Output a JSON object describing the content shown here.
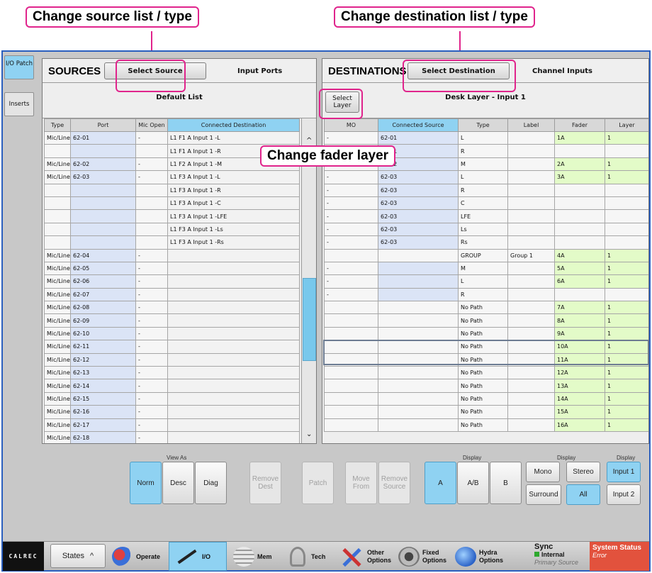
{
  "callouts": {
    "source": "Change source list / type",
    "destination": "Change destination list / type",
    "fader_layer": "Change fader layer"
  },
  "tabs": [
    {
      "label": "I/O Patch",
      "active": true
    },
    {
      "label": "Inserts",
      "active": false
    }
  ],
  "sources": {
    "title": "SOURCES",
    "select_button": "Select Source",
    "subtitle": "Input Ports",
    "list_name": "Default List",
    "columns": [
      "Type",
      "Port",
      "Mic Open",
      "Connected Destination"
    ],
    "rows": [
      [
        "Mic/Line",
        "62-01",
        "-",
        "L1 F1 A Input 1 -L"
      ],
      [
        "",
        "",
        "",
        "L1 F1 A Input 1 -R"
      ],
      [
        "Mic/Line",
        "62-02",
        "-",
        "L1 F2 A Input 1 -M"
      ],
      [
        "Mic/Line",
        "62-03",
        "-",
        "L1 F3 A Input 1 -L"
      ],
      [
        "",
        "",
        "",
        "L1 F3 A Input 1 -R"
      ],
      [
        "",
        "",
        "",
        "L1 F3 A Input 1 -C"
      ],
      [
        "",
        "",
        "",
        "L1 F3 A Input 1 -LFE"
      ],
      [
        "",
        "",
        "",
        "L1 F3 A Input 1 -Ls"
      ],
      [
        "",
        "",
        "",
        "L1 F3 A Input 1 -Rs"
      ],
      [
        "Mic/Line",
        "62-04",
        "-",
        ""
      ],
      [
        "Mic/Line",
        "62-05",
        "-",
        ""
      ],
      [
        "Mic/Line",
        "62-06",
        "-",
        ""
      ],
      [
        "Mic/Line",
        "62-07",
        "-",
        ""
      ],
      [
        "Mic/Line",
        "62-08",
        "-",
        ""
      ],
      [
        "Mic/Line",
        "62-09",
        "-",
        ""
      ],
      [
        "Mic/Line",
        "62-10",
        "-",
        ""
      ],
      [
        "Mic/Line",
        "62-11",
        "-",
        ""
      ],
      [
        "Mic/Line",
        "62-12",
        "-",
        ""
      ],
      [
        "Mic/Line",
        "62-13",
        "-",
        ""
      ],
      [
        "Mic/Line",
        "62-14",
        "-",
        ""
      ],
      [
        "Mic/Line",
        "62-15",
        "-",
        ""
      ],
      [
        "Mic/Line",
        "62-16",
        "-",
        ""
      ],
      [
        "Mic/Line",
        "62-17",
        "-",
        ""
      ],
      [
        "Mic/Line",
        "62-18",
        "-",
        ""
      ]
    ]
  },
  "destinations": {
    "title": "DESTINATIONS",
    "select_button": "Select Destination",
    "subtitle": "Channel Inputs",
    "list_name": "Desk Layer - Input 1",
    "select_layer": "Select Layer",
    "columns": [
      "MO",
      "Connected Source",
      "Type",
      "Label",
      "Fader",
      "Layer"
    ],
    "rows": [
      [
        "-",
        "62-01",
        "L",
        "",
        "1A",
        "1"
      ],
      [
        "",
        "62-01",
        "R",
        "",
        "",
        ""
      ],
      [
        "-",
        "62-02",
        "M",
        "",
        "2A",
        "1"
      ],
      [
        "-",
        "62-03",
        "L",
        "",
        "3A",
        "1"
      ],
      [
        "-",
        "62-03",
        "R",
        "",
        "",
        ""
      ],
      [
        "-",
        "62-03",
        "C",
        "",
        "",
        ""
      ],
      [
        "-",
        "62-03",
        "LFE",
        "",
        "",
        ""
      ],
      [
        "-",
        "62-03",
        "Ls",
        "",
        "",
        ""
      ],
      [
        "-",
        "62-03",
        "Rs",
        "",
        "",
        ""
      ],
      [
        "",
        "",
        "GROUP",
        "Group 1",
        "4A",
        "1"
      ],
      [
        "-",
        "",
        "M",
        "",
        "5A",
        "1"
      ],
      [
        "-",
        "",
        "L",
        "",
        "6A",
        "1"
      ],
      [
        "-",
        "",
        "R",
        "",
        "",
        ""
      ],
      [
        "",
        "",
        "No Path",
        "",
        "7A",
        "1"
      ],
      [
        "",
        "",
        "No Path",
        "",
        "8A",
        "1"
      ],
      [
        "",
        "",
        "No Path",
        "",
        "9A",
        "1"
      ],
      [
        "",
        "",
        "No Path",
        "",
        "10A",
        "1"
      ],
      [
        "",
        "",
        "No Path",
        "",
        "11A",
        "1"
      ],
      [
        "",
        "",
        "No Path",
        "",
        "12A",
        "1"
      ],
      [
        "",
        "",
        "No Path",
        "",
        "13A",
        "1"
      ],
      [
        "",
        "",
        "No Path",
        "",
        "14A",
        "1"
      ],
      [
        "",
        "",
        "No Path",
        "",
        "15A",
        "1"
      ],
      [
        "",
        "",
        "No Path",
        "",
        "16A",
        "1"
      ]
    ]
  },
  "controls": {
    "view_as_label": "View As",
    "norm": "Norm",
    "desc": "Desc",
    "diag": "Diag",
    "remove_dest": "Remove Dest",
    "patch": "Patch",
    "move_from": "Move From",
    "remove_source": "Remove Source",
    "display_label": "Display",
    "a": "A",
    "ab": "A/B",
    "b": "B",
    "mono": "Mono",
    "stereo": "Stereo",
    "surround": "Surround",
    "all": "All",
    "input1": "Input 1",
    "input2": "Input 2"
  },
  "bottom_bar": {
    "logo": "CALREC",
    "states": "States",
    "operate": "Operate",
    "io": "I/O",
    "mem": "Mem",
    "tech": "Tech",
    "other_options": "Other Options",
    "fixed_options": "Fixed Options",
    "hydra_options": "Hydra Options",
    "sync_title": "Sync",
    "sync_value": "Internal",
    "sync_sub": "Primary Source",
    "status_title": "System Status",
    "status_value": "Error"
  },
  "colors": {
    "accent_blue": "#8fd2f2",
    "callout_pink": "#e0248c",
    "fader_green": "#e3fbc8",
    "status_red": "#e2523d"
  }
}
